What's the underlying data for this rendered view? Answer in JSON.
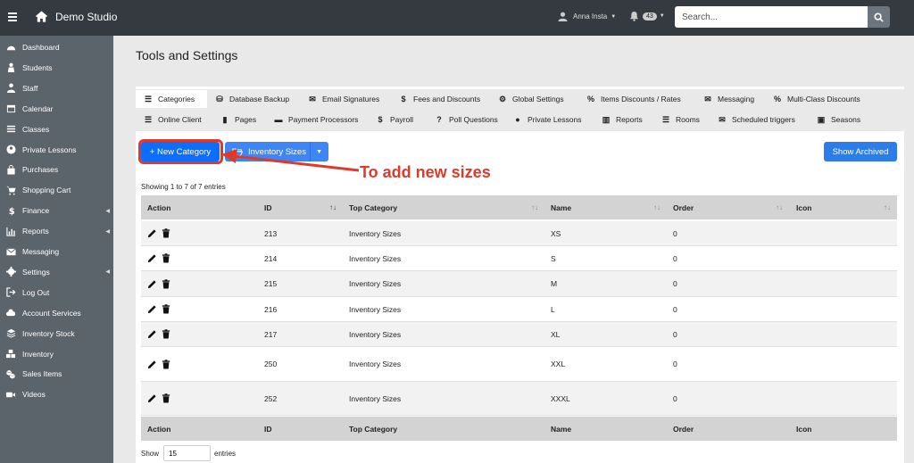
{
  "header": {
    "brand": "Demo Studio",
    "user_name": "Anna Insta",
    "notification_count": "43",
    "search_placeholder": "Search..."
  },
  "sidebar": {
    "items": [
      {
        "label": "Dashboard",
        "icon": "dashboard-icon",
        "submenu": false
      },
      {
        "label": "Students",
        "icon": "student-icon",
        "submenu": false
      },
      {
        "label": "Staff",
        "icon": "staff-icon",
        "submenu": false
      },
      {
        "label": "Calendar",
        "icon": "calendar-icon",
        "submenu": false
      },
      {
        "label": "Classes",
        "icon": "classes-icon",
        "submenu": false
      },
      {
        "label": "Private Lessons",
        "icon": "user-circle-icon",
        "submenu": false
      },
      {
        "label": "Purchases",
        "icon": "bag-icon",
        "submenu": false
      },
      {
        "label": "Shopping Cart",
        "icon": "cart-icon",
        "submenu": false
      },
      {
        "label": "Finance",
        "icon": "dollar-icon",
        "submenu": true
      },
      {
        "label": "Reports",
        "icon": "chart-icon",
        "submenu": true
      },
      {
        "label": "Messaging",
        "icon": "envelope-icon",
        "submenu": false
      },
      {
        "label": "Settings",
        "icon": "gear-icon",
        "submenu": true
      },
      {
        "label": "Log Out",
        "icon": "logout-icon",
        "submenu": false
      },
      {
        "label": "Account Services",
        "icon": "cloud-icon",
        "submenu": false
      },
      {
        "label": "Inventory Stock",
        "icon": "layers-icon",
        "submenu": false
      },
      {
        "label": "Inventory",
        "icon": "boxes-icon",
        "submenu": false
      },
      {
        "label": "Sales Items",
        "icon": "cubes-icon",
        "submenu": false
      },
      {
        "label": "Videos",
        "icon": "video-icon",
        "submenu": false
      }
    ]
  },
  "page": {
    "title": "Tools and Settings"
  },
  "tabs": {
    "row1": [
      {
        "label": "Categories",
        "glyph": "☰",
        "active": true
      },
      {
        "label": "Database Backup",
        "glyph": "⛁",
        "active": false
      },
      {
        "label": "Email Signatures",
        "glyph": "✉",
        "active": false
      },
      {
        "label": "Fees and Discounts",
        "glyph": "$",
        "active": false
      },
      {
        "label": "Global Settings",
        "glyph": "⚙",
        "active": false
      },
      {
        "label": "Items Discounts / Rates",
        "glyph": "%",
        "active": false
      },
      {
        "label": "Messaging",
        "glyph": "✉",
        "active": false
      },
      {
        "label": "Multi-Class Discounts",
        "glyph": "%",
        "active": false
      }
    ],
    "row2": [
      {
        "label": "Online Client",
        "glyph": "☰",
        "active": false
      },
      {
        "label": "Pages",
        "glyph": "▮",
        "active": false
      },
      {
        "label": "Payment Processors",
        "glyph": "▬",
        "active": false
      },
      {
        "label": "Payroll",
        "glyph": "$",
        "active": false
      },
      {
        "label": "Poll Questions",
        "glyph": "?",
        "active": false
      },
      {
        "label": "Private Lessons",
        "glyph": "●",
        "active": false
      },
      {
        "label": "Reports",
        "glyph": "▥",
        "active": false
      },
      {
        "label": "Rooms",
        "glyph": "☰",
        "active": false
      },
      {
        "label": "Scheduled triggers",
        "glyph": "✉",
        "active": false
      },
      {
        "label": "Seasons",
        "glyph": "▣",
        "active": false
      }
    ]
  },
  "toolbar": {
    "new_category_label": "+ New Category",
    "inventory_sizes_label": "Inventory Sizes",
    "show_archived_label": "Show Archived"
  },
  "annotation": {
    "text": "To add new sizes",
    "color": "#e0392a"
  },
  "table": {
    "info": "Showing 1 to 7 of 7 entries",
    "columns": [
      "Action",
      "ID",
      "Top Category",
      "Name",
      "Order",
      "Icon"
    ],
    "rows": [
      {
        "id": "213",
        "top_category": "Inventory Sizes",
        "name": "XS",
        "order": "0",
        "icon": ""
      },
      {
        "id": "214",
        "top_category": "Inventory Sizes",
        "name": "S",
        "order": "0",
        "icon": ""
      },
      {
        "id": "215",
        "top_category": "Inventory Sizes",
        "name": "M",
        "order": "0",
        "icon": ""
      },
      {
        "id": "216",
        "top_category": "Inventory Sizes",
        "name": "L",
        "order": "0",
        "icon": ""
      },
      {
        "id": "217",
        "top_category": "Inventory Sizes",
        "name": "XL",
        "order": "0",
        "icon": ""
      },
      {
        "id": "250",
        "top_category": "Inventory Sizes",
        "name": "XXL",
        "order": "0",
        "icon": ""
      },
      {
        "id": "252",
        "top_category": "Inventory Sizes",
        "name": "XXXL",
        "order": "0",
        "icon": ""
      }
    ],
    "show_label": "Show",
    "page_size": "15",
    "entries_label": "entries"
  },
  "colors": {
    "topbar": "#343a40",
    "sidebar": "#5b636b",
    "primary": "#0d6efd",
    "annotation_red": "#e0392a"
  }
}
